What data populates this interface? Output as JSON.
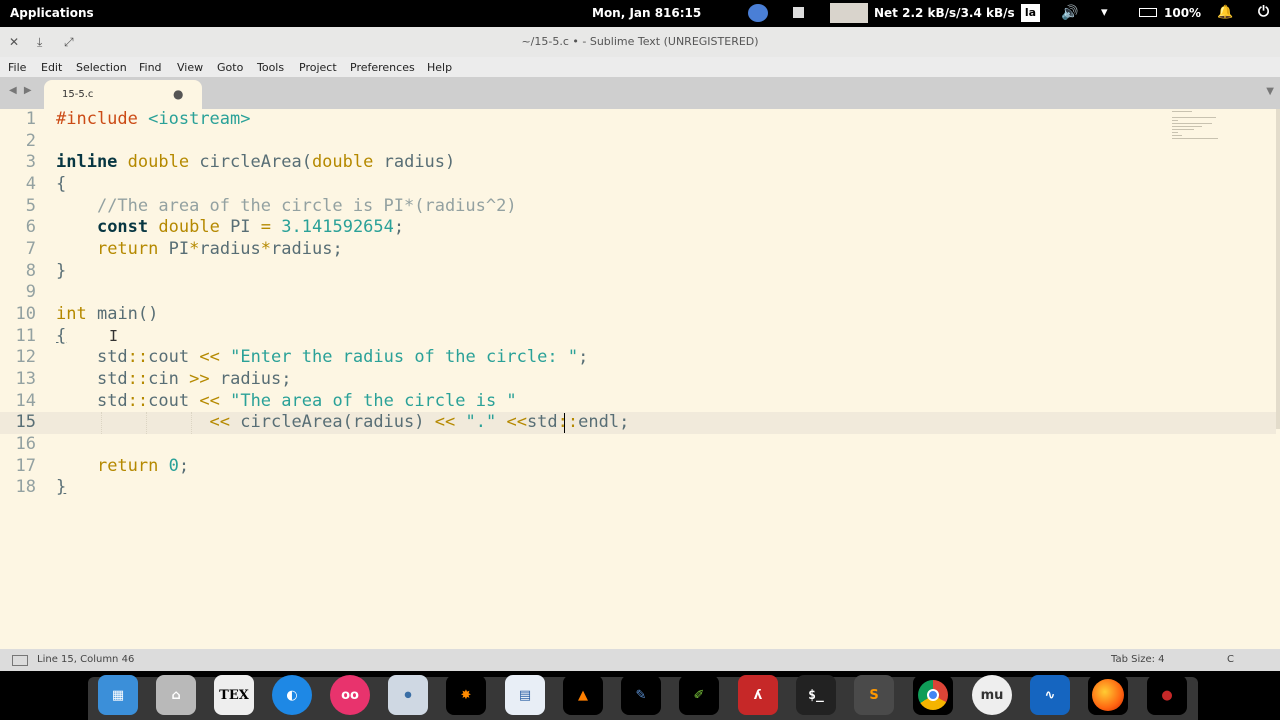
{
  "topbar": {
    "applications": "Applications",
    "date": "Mon, Jan 8",
    "time": "16:15",
    "net": "Net 2.2 kB/s/3.4 kB/s",
    "kbd": "la",
    "battery": "100%"
  },
  "window": {
    "title": "~/15-5.c • - Sublime Text (UNREGISTERED)",
    "close": "✕",
    "minimize": "⤓",
    "maximize": "⤢"
  },
  "menu": [
    "File",
    "Edit",
    "Selection",
    "Find",
    "View",
    "Goto",
    "Tools",
    "Project",
    "Preferences",
    "Help"
  ],
  "tabs": {
    "active": "15-5.c",
    "dirty_marker": "●",
    "nav": "◀ ▶",
    "dropdown": "▼"
  },
  "editor": {
    "line_numbers": [
      "1",
      "2",
      "3",
      "4",
      "5",
      "6",
      "7",
      "8",
      "9",
      "10",
      "11",
      "12",
      "13",
      "14",
      "15",
      "16",
      "17",
      "18"
    ],
    "code": {
      "l1_pp": "#include",
      "l1_hdr": "<iostream>",
      "l3_inline": "inline",
      "l3_double": "double",
      "l3_fn": "circleArea(",
      "l3_double2": "double",
      "l3_rest": "radius)",
      "l4": "{",
      "l5_comment": "//The area of the circle is PI*(radius^2)",
      "l6_const": "const",
      "l6_double": "double",
      "l6_pi": "PI",
      "l6_eq": "=",
      "l6_num": "3.141592654",
      "l6_semi": ";",
      "l7_return": "return",
      "l7_a": "PI",
      "l7_op1": "*",
      "l7_b": "radius",
      "l7_op2": "*",
      "l7_c": "radius;",
      "l8": "}",
      "l10_int": "int",
      "l10_main": "main()",
      "l11": "{",
      "l12_std": "std",
      "l12_sep": "::",
      "l12_cout": "cout",
      "l12_op": "<<",
      "l12_str": "\"Enter the radius of the circle: \"",
      "l12_semi": ";",
      "l13_std": "std",
      "l13_sep": "::",
      "l13_cin": "cin",
      "l13_op": ">>",
      "l13_rest": "radius;",
      "l14_std": "std",
      "l14_sep": "::",
      "l14_cout": "cout",
      "l14_op": "<<",
      "l14_str": "\"The area of the circle is \"",
      "l15_op1": "<<",
      "l15_call": "circleArea(radius)",
      "l15_op2": "<<",
      "l15_str": "\".\"",
      "l15_op3": "<<",
      "l15_std": "std",
      "l15_sep": "::",
      "l15_endl": "endl;",
      "l17_return": "return",
      "l17_num": "0",
      "l17_semi": ";",
      "l18": "}"
    }
  },
  "status": {
    "position": "Line 15, Column 46",
    "tab_size": "Tab Size: 4",
    "syntax": "C"
  },
  "dock": {
    "tex": "TEX",
    "terminal": "$_",
    "sublime": "S"
  }
}
